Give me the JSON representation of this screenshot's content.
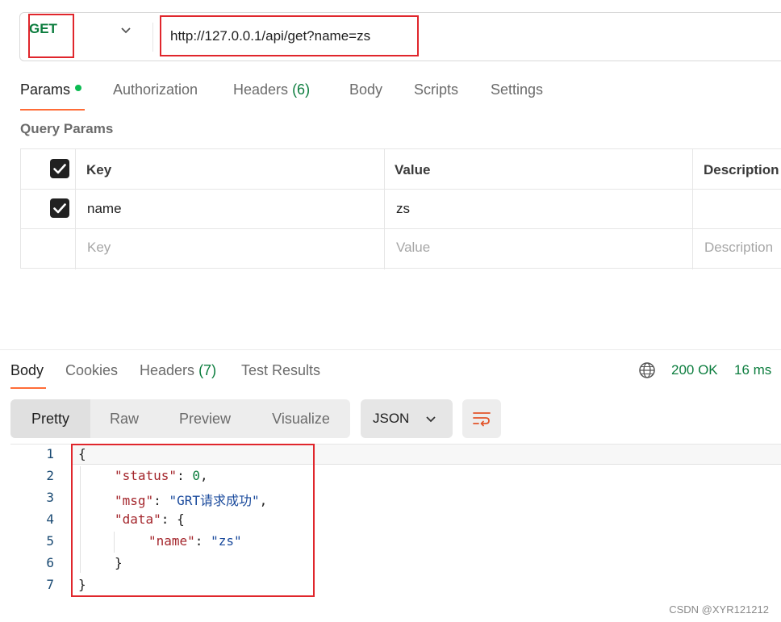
{
  "request": {
    "method": "GET",
    "url": "http://127.0.0.1/api/get?name=zs"
  },
  "request_tabs": {
    "params": "Params",
    "authorization": "Authorization",
    "headers": "Headers",
    "headers_count": "(6)",
    "body": "Body",
    "scripts": "Scripts",
    "settings": "Settings"
  },
  "query_params": {
    "title": "Query Params",
    "headers": [
      "Key",
      "Value",
      "Description"
    ],
    "rows": [
      {
        "checked": true,
        "key": "name",
        "value": "zs",
        "description": ""
      }
    ],
    "placeholders": {
      "key": "Key",
      "value": "Value",
      "description": "Description"
    }
  },
  "response_tabs": {
    "body": "Body",
    "cookies": "Cookies",
    "headers": "Headers",
    "headers_count": "(7)",
    "test_results": "Test Results"
  },
  "response_status": {
    "status": "200 OK",
    "time": "16 ms"
  },
  "view_modes": [
    "Pretty",
    "Raw",
    "Preview",
    "Visualize"
  ],
  "format": "JSON",
  "code": {
    "line_numbers": [
      "1",
      "2",
      "3",
      "4",
      "5",
      "6",
      "7"
    ],
    "lines": {
      "l1": "{",
      "l2_key": "\"status\"",
      "l2_sep": ": ",
      "l2_val": "0",
      "l2_end": ",",
      "l3_key": "\"msg\"",
      "l3_sep": ": ",
      "l3_val": "\"GRT请求成功\"",
      "l3_end": ",",
      "l4_key": "\"data\"",
      "l4_rest": ": {",
      "l5_key": "\"name\"",
      "l5_sep": ": ",
      "l5_val": "\"zs\"",
      "l6": "}",
      "l7": "}"
    }
  },
  "colors": {
    "method_green": "#0c7d3e",
    "accent_orange": "#ff6c37",
    "highlight_red": "#e0262c"
  },
  "icons": [
    "chevron-down-icon",
    "checkbox-checked-icon",
    "globe-icon",
    "chevron-down-icon",
    "wrap-lines-icon"
  ],
  "watermark": "CSDN @XYR121212"
}
